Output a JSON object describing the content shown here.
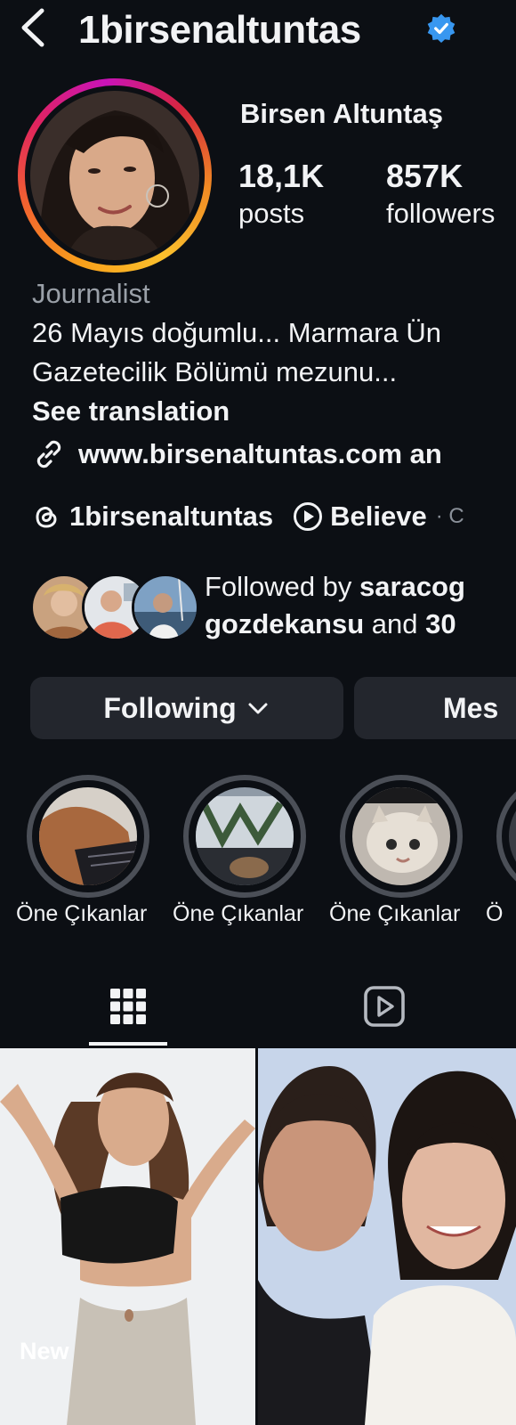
{
  "header": {
    "username": "1birsenaltuntas",
    "back_icon": "chevron-left-icon",
    "verified_icon": "verified-badge-icon",
    "verified_color": "#3897f0"
  },
  "profile": {
    "display_name": "Birsen Altuntaş",
    "stats": [
      {
        "value": "18,1K",
        "label": "posts"
      },
      {
        "value": "857K",
        "label": "followers"
      }
    ],
    "category": "Journalist",
    "bio_line1": "26 Mayıs doğumlu... Marmara Ün",
    "bio_line2": "Gazetecilik Bölümü mezunu...",
    "see_translation": "See translation",
    "link": "www.birsenaltuntas.com an",
    "threads_handle": "1birsenaltuntas",
    "music_title": "Believe",
    "music_sep": "· C"
  },
  "followed_by": {
    "prefix": "Followed by ",
    "user1": "saracog",
    "user2": "gozdekansu",
    "middle": " and ",
    "count": "30"
  },
  "actions": {
    "following_label": "Following",
    "message_label": "Mes"
  },
  "highlights": [
    {
      "label": "Öne Çıkanlar"
    },
    {
      "label": "Öne Çıkanlar"
    },
    {
      "label": "Öne Çıkanlar"
    },
    {
      "label": "Ö"
    }
  ],
  "tabs": {
    "grid_icon": "grid-icon",
    "reels_icon": "reels-icon"
  },
  "posts": {
    "first_badge": "New"
  },
  "colors": {
    "background": "#0c0f14",
    "button_bg": "#23262d",
    "muted_text": "#9aa0a8"
  }
}
